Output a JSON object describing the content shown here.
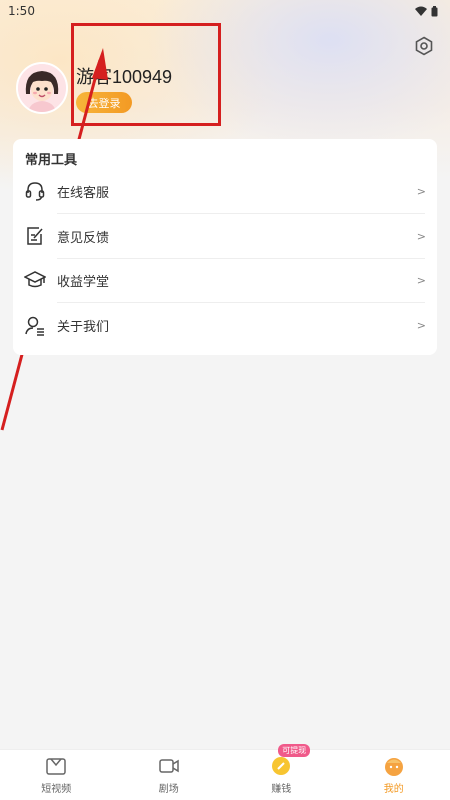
{
  "status_bar": {
    "time": "1:50"
  },
  "profile": {
    "username": "游客100949",
    "login_button": "去登录"
  },
  "tools": {
    "title": "常用工具",
    "items": [
      {
        "label": "在线客服",
        "icon": "headset-icon",
        "chevron": ">"
      },
      {
        "label": "意见反馈",
        "icon": "feedback-edit-icon",
        "chevron": ">"
      },
      {
        "label": "收益学堂",
        "icon": "graduation-cap-icon",
        "chevron": ">"
      },
      {
        "label": "关于我们",
        "icon": "about-person-icon",
        "chevron": ">"
      }
    ]
  },
  "tab_bar": {
    "items": [
      {
        "label": "短视频",
        "icon": "short-video-icon"
      },
      {
        "label": "剧场",
        "icon": "theater-camera-icon"
      },
      {
        "label": "赚钱",
        "icon": "coin-icon",
        "badge": "可提现"
      },
      {
        "label": "我的",
        "icon": "mine-avatar-icon",
        "active": true
      }
    ]
  },
  "colors": {
    "accent": "#f39a24",
    "annotation_red": "#d51f1f",
    "badge_pink": "#f05a8a"
  }
}
